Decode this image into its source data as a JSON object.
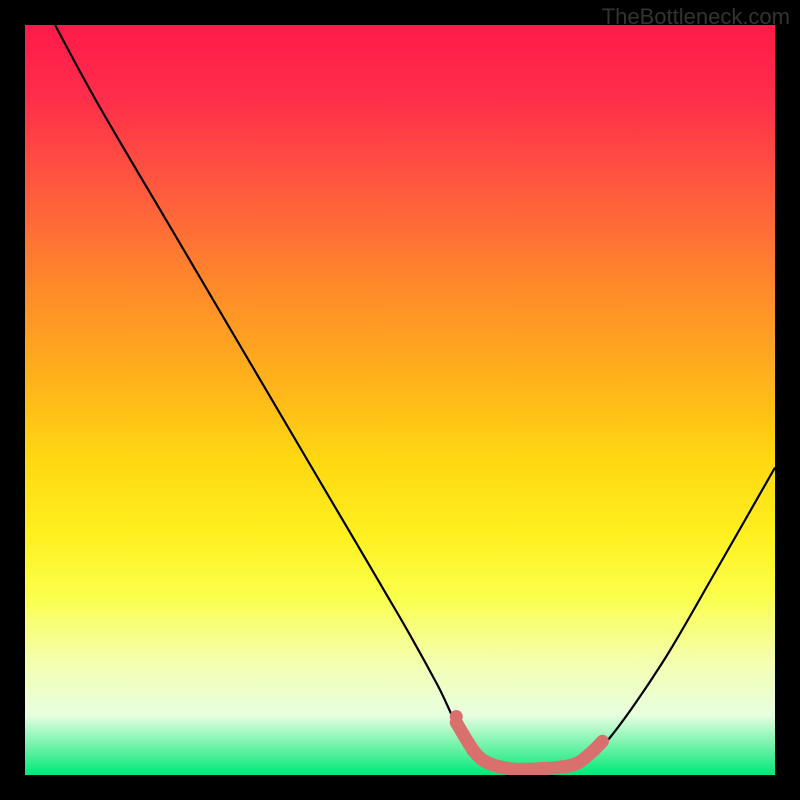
{
  "watermark": "TheBottleneck.com",
  "chart_data": {
    "type": "line",
    "title": "",
    "xlabel": "",
    "ylabel": "",
    "xlim": [
      0,
      100
    ],
    "ylim": [
      0,
      100
    ],
    "series": [
      {
        "name": "curve",
        "x": [
          4,
          10,
          20,
          30,
          40,
          50,
          55,
          58,
          62,
          66,
          70,
          74,
          78,
          85,
          92,
          100
        ],
        "y": [
          100,
          89,
          72,
          55,
          38,
          21,
          12,
          6,
          1.5,
          0.5,
          0.5,
          1.5,
          5,
          15,
          27,
          41
        ]
      }
    ],
    "highlight_region": {
      "color": "#d9706e",
      "x": [
        57.5,
        60,
        62,
        65,
        68,
        71,
        73.5,
        75.5,
        77
      ],
      "y": [
        7,
        3,
        1.5,
        0.8,
        0.8,
        1,
        1.5,
        3,
        4.5
      ]
    },
    "background_gradient": {
      "type": "vertical",
      "stops": [
        {
          "pos": 0.0,
          "color": "#ff1a4a"
        },
        {
          "pos": 0.35,
          "color": "#ff8a2a"
        },
        {
          "pos": 0.68,
          "color": "#fff020"
        },
        {
          "pos": 0.92,
          "color": "#e8ffe0"
        },
        {
          "pos": 1.0,
          "color": "#00e878"
        }
      ]
    }
  }
}
